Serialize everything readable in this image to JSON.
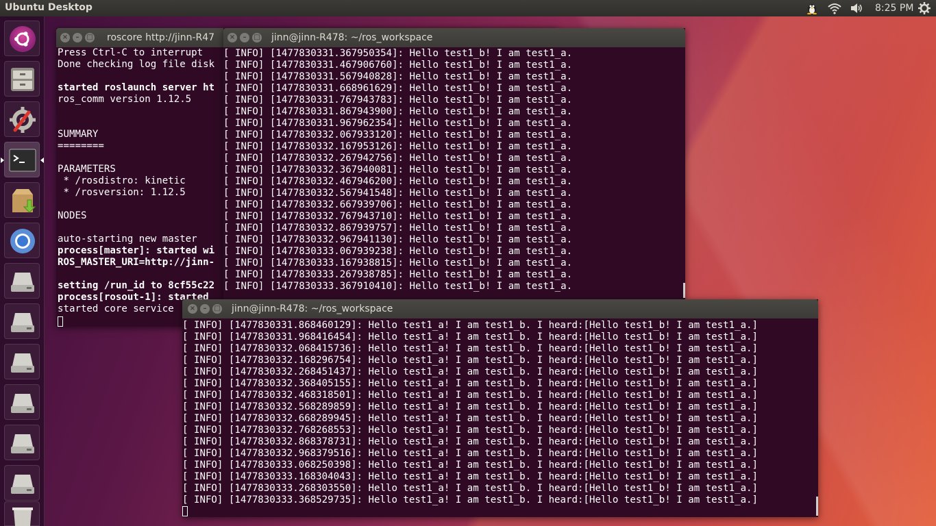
{
  "top_panel": {
    "title": "Ubuntu Desktop",
    "time": "8:25 PM",
    "icons": [
      "tux-icon",
      "wifi-icon",
      "volume-icon",
      "settings-gear-icon"
    ]
  },
  "launcher": {
    "items": [
      "ubuntu-dash-icon",
      "files-icon",
      "system-settings-icon",
      "terminal-icon",
      "software-updater-icon",
      "chromium-icon",
      "drive-icon",
      "drive-icon",
      "drive-icon",
      "drive-icon",
      "drive-icon",
      "drive-icon",
      "trash-icon"
    ]
  },
  "roscore": {
    "title": "roscore http://jinn-R47",
    "lines": [
      {
        "t": "Press Ctrl-C to interrupt",
        "b": false
      },
      {
        "t": "Done checking log file disk",
        "b": false
      },
      {
        "t": "",
        "b": false
      },
      {
        "t": "started roslaunch server ht",
        "b": true
      },
      {
        "t": "ros_comm version 1.12.5",
        "b": false
      },
      {
        "t": "",
        "b": false
      },
      {
        "t": "",
        "b": false
      },
      {
        "t": "SUMMARY",
        "b": false
      },
      {
        "t": "========",
        "b": false
      },
      {
        "t": "",
        "b": false
      },
      {
        "t": "PARAMETERS",
        "b": false
      },
      {
        "t": " * /rosdistro: kinetic",
        "b": false
      },
      {
        "t": " * /rosversion: 1.12.5",
        "b": false
      },
      {
        "t": "",
        "b": false
      },
      {
        "t": "NODES",
        "b": false
      },
      {
        "t": "",
        "b": false
      },
      {
        "t": "auto-starting new master",
        "b": false
      },
      {
        "t": "process[master]: started wi",
        "b": true
      },
      {
        "t": "ROS_MASTER_URI=http://jinn-",
        "b": true
      },
      {
        "t": "",
        "b": false
      },
      {
        "t": "setting /run_id to 8cf55c22",
        "b": true
      },
      {
        "t": "process[rosout-1]: started",
        "b": true
      },
      {
        "t": "started core service",
        "b": false
      }
    ]
  },
  "talker": {
    "title": "jinn@jinn-R478: ~/ros_workspace",
    "lines": [
      "[ INFO] [1477830331.367950354]: Hello test1_b! I am test1_a.",
      "[ INFO] [1477830331.467906760]: Hello test1_b! I am test1_a.",
      "[ INFO] [1477830331.567940828]: Hello test1_b! I am test1_a.",
      "[ INFO] [1477830331.668961629]: Hello test1_b! I am test1_a.",
      "[ INFO] [1477830331.767943783]: Hello test1_b! I am test1_a.",
      "[ INFO] [1477830331.867943900]: Hello test1_b! I am test1_a.",
      "[ INFO] [1477830331.967962354]: Hello test1_b! I am test1_a.",
      "[ INFO] [1477830332.067933120]: Hello test1_b! I am test1_a.",
      "[ INFO] [1477830332.167953126]: Hello test1_b! I am test1_a.",
      "[ INFO] [1477830332.267942756]: Hello test1_b! I am test1_a.",
      "[ INFO] [1477830332.367940081]: Hello test1_b! I am test1_a.",
      "[ INFO] [1477830332.467946200]: Hello test1_b! I am test1_a.",
      "[ INFO] [1477830332.567941548]: Hello test1_b! I am test1_a.",
      "[ INFO] [1477830332.667939706]: Hello test1_b! I am test1_a.",
      "[ INFO] [1477830332.767943710]: Hello test1_b! I am test1_a.",
      "[ INFO] [1477830332.867939757]: Hello test1_b! I am test1_a.",
      "[ INFO] [1477830332.967941130]: Hello test1_b! I am test1_a.",
      "[ INFO] [1477830333.067939238]: Hello test1_b! I am test1_a.",
      "[ INFO] [1477830333.167938815]: Hello test1_b! I am test1_a.",
      "[ INFO] [1477830333.267938785]: Hello test1_b! I am test1_a.",
      "[ INFO] [1477830333.367910410]: Hello test1_b! I am test1_a."
    ]
  },
  "listener": {
    "title": "jinn@jinn-R478: ~/ros_workspace",
    "lines": [
      "[ INFO] [1477830331.868460129]: Hello test1_a! I am test1_b. I heard:[Hello test1_b! I am test1_a.]",
      "[ INFO] [1477830331.968416454]: Hello test1_a! I am test1_b. I heard:[Hello test1_b! I am test1_a.]",
      "[ INFO] [1477830332.068415736]: Hello test1_a! I am test1_b. I heard:[Hello test1_b! I am test1_a.]",
      "[ INFO] [1477830332.168296754]: Hello test1_a! I am test1_b. I heard:[Hello test1_b! I am test1_a.]",
      "[ INFO] [1477830332.268451437]: Hello test1_a! I am test1_b. I heard:[Hello test1_b! I am test1_a.]",
      "[ INFO] [1477830332.368405155]: Hello test1_a! I am test1_b. I heard:[Hello test1_b! I am test1_a.]",
      "[ INFO] [1477830332.468318501]: Hello test1_a! I am test1_b. I heard:[Hello test1_b! I am test1_a.]",
      "[ INFO] [1477830332.568289859]: Hello test1_a! I am test1_b. I heard:[Hello test1_b! I am test1_a.]",
      "[ INFO] [1477830332.668289945]: Hello test1_a! I am test1_b. I heard:[Hello test1_b! I am test1_a.]",
      "[ INFO] [1477830332.768268553]: Hello test1_a! I am test1_b. I heard:[Hello test1_b! I am test1_a.]",
      "[ INFO] [1477830332.868378731]: Hello test1_a! I am test1_b. I heard:[Hello test1_b! I am test1_a.]",
      "[ INFO] [1477830332.968379516]: Hello test1_a! I am test1_b. I heard:[Hello test1_b! I am test1_a.]",
      "[ INFO] [1477830333.068250398]: Hello test1_a! I am test1_b. I heard:[Hello test1_b! I am test1_a.]",
      "[ INFO] [1477830333.168304043]: Hello test1_a! I am test1_b. I heard:[Hello test1_b! I am test1_a.]",
      "[ INFO] [1477830333.268303550]: Hello test1_a! I am test1_b. I heard:[Hello test1_b! I am test1_a.]",
      "[ INFO] [1477830333.368529735]: Hello test1_a! I am test1_b. I heard:[Hello test1_b! I am test1_a.]"
    ]
  }
}
